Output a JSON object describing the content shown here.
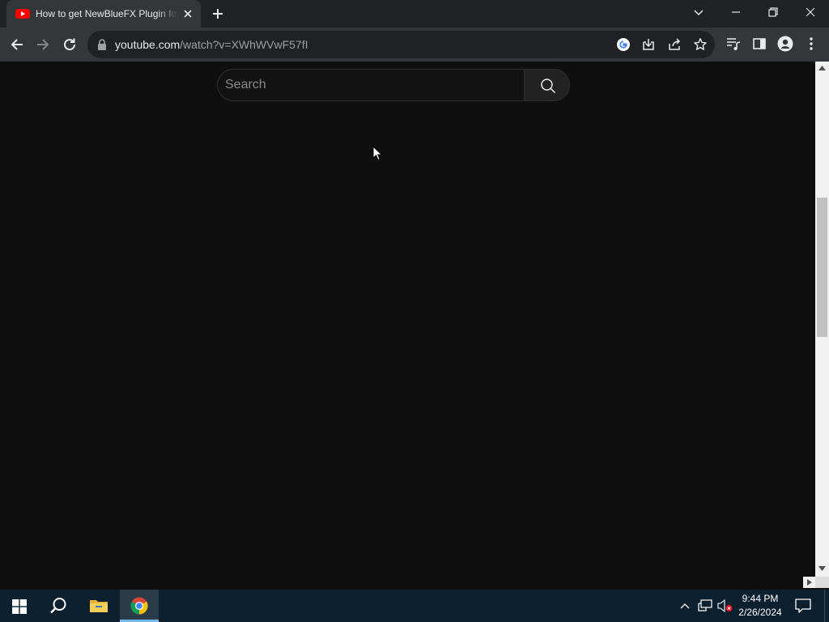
{
  "browser": {
    "tab": {
      "title": "How to get NewBlueFX Plugin for Vegas Pro"
    },
    "url": {
      "host": "youtube.com",
      "path": "/watch?v=XWhWVwF57fI"
    }
  },
  "page": {
    "search": {
      "placeholder": "Search",
      "value": ""
    }
  },
  "taskbar": {
    "clock": {
      "time": "9:44 PM",
      "date": "2/26/2024"
    }
  },
  "colors": {
    "page_background": "#0f0f0f",
    "tab_strip": "#202124",
    "toolbar": "#35363a",
    "taskbar": "#0c2030",
    "youtube_red": "#ff0000"
  },
  "icons": [
    "youtube-favicon-icon",
    "close-icon",
    "plus-icon",
    "chevron-down-icon",
    "minimize-icon",
    "restore-icon",
    "arrow-left-icon",
    "arrow-right-icon",
    "reload-icon",
    "lock-icon",
    "google-icon",
    "install-icon",
    "share-icon",
    "star-icon",
    "media-control-icon",
    "side-panel-icon",
    "profile-icon",
    "more-vert-icon",
    "search-icon",
    "windows-logo-icon",
    "folder-icon",
    "chrome-icon",
    "network-icon",
    "volume-muted-icon",
    "notification-icon"
  ]
}
